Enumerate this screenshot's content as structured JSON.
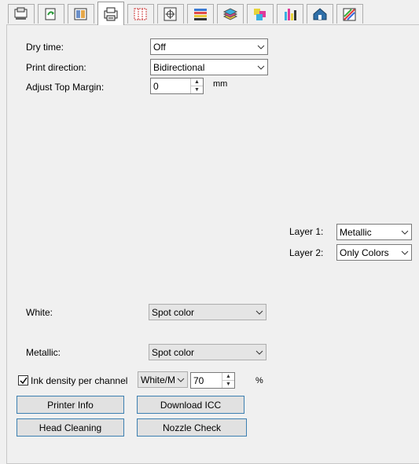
{
  "tabs": [
    {
      "icon": "printer-settings-icon"
    },
    {
      "icon": "rotate-page-icon"
    },
    {
      "icon": "layout-icon"
    },
    {
      "icon": "printer-icon"
    },
    {
      "icon": "page-grid-icon"
    },
    {
      "icon": "registration-mark-icon"
    },
    {
      "icon": "color-bars-icon"
    },
    {
      "icon": "layers-icon"
    },
    {
      "icon": "color-swatches-icon"
    },
    {
      "icon": "ink-levels-icon"
    },
    {
      "icon": "house-profile-icon"
    },
    {
      "icon": "color-picker-icon"
    }
  ],
  "active_tab_index": 3,
  "form": {
    "dry_time": {
      "label": "Dry time:",
      "value": "Off"
    },
    "print_direction": {
      "label": "Print direction:",
      "value": "Bidirectional"
    },
    "adjust_top_margin": {
      "label": "Adjust Top Margin:",
      "value": "0",
      "unit": "mm"
    },
    "layer1": {
      "label": "Layer 1:",
      "value": "Metallic"
    },
    "layer2": {
      "label": "Layer 2:",
      "value": "Only Colors"
    },
    "white": {
      "label": "White:",
      "value": "Spot color"
    },
    "metallic": {
      "label": "Metallic:",
      "value": "Spot color"
    },
    "ink_density": {
      "label": "Ink density per channel",
      "checked": true,
      "channel": "White/M",
      "value": "70",
      "unit": "%"
    }
  },
  "buttons": {
    "printer_info": "Printer Info",
    "download_icc": "Download ICC",
    "head_cleaning": "Head Cleaning",
    "nozzle_check": "Nozzle Check"
  }
}
